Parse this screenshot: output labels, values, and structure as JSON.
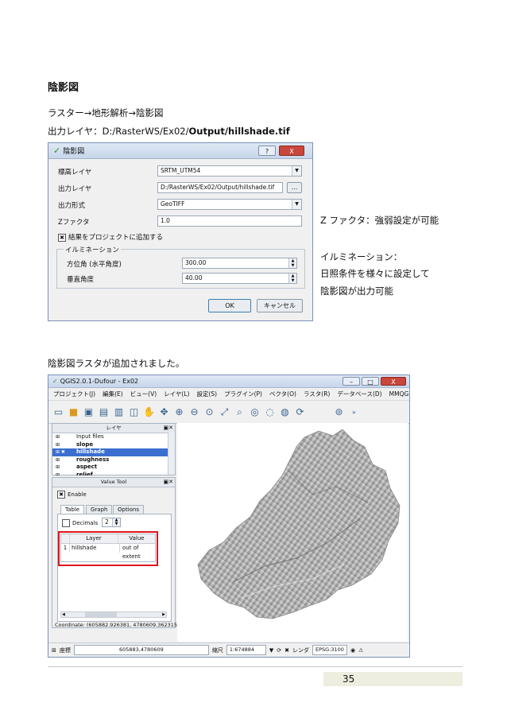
{
  "heading": "陰影図",
  "path_line": "ラスター→地形解析→陰影図",
  "output_line_prefix": "出力レイヤ：D:/RasterWS/Ex02/",
  "output_line_bold": "Output/hillshade.tif",
  "dialog": {
    "title": "陰影図",
    "help_btn": "?",
    "close_btn": "X",
    "fields": [
      {
        "label": "標高レイヤ",
        "value": "SRTM_UTM54"
      },
      {
        "label": "出力レイヤ",
        "value": "D:/RasterWS/Ex02/Output/hillshade.tif"
      },
      {
        "label": "出力形式",
        "value": "GeoTIFF"
      },
      {
        "label": "Zファクタ",
        "value": "1.0"
      }
    ],
    "browse_btn": "...",
    "add_to_project": "結果をプロジェクトに追加する",
    "group_title": "イルミネーション",
    "azimuth_label": "方位角 (水平角度)",
    "azimuth_value": "300.00",
    "vertical_label": "垂直角度",
    "vertical_value": "40.00",
    "ok_btn": "OK",
    "cancel_btn": "キャンセル"
  },
  "notes": {
    "z_factor": "Z ファクタ：強弱設定が可能",
    "illum_1": "イルミネーション：",
    "illum_2": "日照条件を様々に設定して",
    "illum_3": "陰影図が出力可能"
  },
  "added_text": "陰影図ラスタが追加されました。",
  "qgis": {
    "title": "QGIS2.0.1-Dufour - Ex02",
    "menu": [
      "プロジェクト(J)",
      "編集(E)",
      "ビュー(V)",
      "レイヤ(L)",
      "設定(S)",
      "プラグイン(P)",
      "ベクタ(O)",
      "ラスタ(R)",
      "データベース(D)",
      "MMQGIS",
      "»"
    ],
    "layers_panel_title": "レイヤ",
    "layers": [
      "Input files",
      "slope",
      "hillshade",
      "roughness",
      "aspect",
      "relief"
    ],
    "selected_layer": "hillshade",
    "value_tool_title": "Value Tool",
    "enable_label": "Enable",
    "tabs": [
      "Table",
      "Graph",
      "Options"
    ],
    "decimals_label": "Decimals",
    "decimals_value": "2",
    "table_headers": [
      "Layer",
      "Value"
    ],
    "table_row": {
      "index": "1",
      "layer": "hillshade",
      "value": "out of extent"
    },
    "coordinate_line": "Coordinate: (605882.926381, 4780609.362315)",
    "status": {
      "coord_label": "座標",
      "coord_value": "605883,4780609",
      "scale_label": "縮尺",
      "scale_value": "1:674884",
      "render_label": "レンダ",
      "epsg": "EPSG:3100"
    }
  },
  "page_number": "35"
}
